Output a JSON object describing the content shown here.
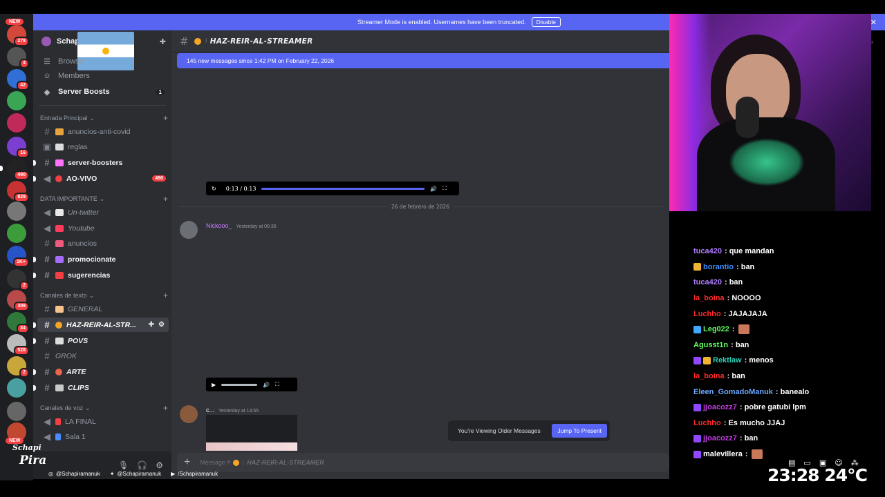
{
  "streamer_banner": {
    "text": "Streamer Mode is enabled. Usernames have been truncated.",
    "disable_label": "Disable"
  },
  "rail": {
    "new_top": "NEW",
    "new_bottom": "NEW",
    "badges": [
      "278",
      "4",
      "42",
      "",
      "",
      "16",
      "490",
      "829",
      "",
      "",
      "1K+",
      "2",
      "309",
      "34",
      "528",
      "2",
      "",
      "",
      ""
    ]
  },
  "server": {
    "name": "Schapi"
  },
  "sidebar": {
    "top": [
      {
        "label": "Browse",
        "icon": "browse-icon"
      },
      {
        "label": "Members",
        "icon": "members-icon"
      },
      {
        "label": "Server Boosts",
        "icon": "boost-icon",
        "count": "1"
      }
    ],
    "categories": [
      {
        "label": "Entrada Principal"
      },
      {
        "label": "DATA IMPORTANTE"
      },
      {
        "label": "Canales de texto"
      },
      {
        "label": "Canales de voz"
      }
    ],
    "channels": [
      {
        "label": "anuncios-anti-covid"
      },
      {
        "label": "reglas"
      },
      {
        "label": "server-boosters"
      },
      {
        "label": "AO-VIVO",
        "count": "490"
      },
      {
        "label": "Un-twitter"
      },
      {
        "label": "Youtube"
      },
      {
        "label": "anuncios"
      },
      {
        "label": "promocionate"
      },
      {
        "label": "sugerencias"
      },
      {
        "label": "GENERAL"
      },
      {
        "label": "HAZ-REIR-AL-STR..."
      },
      {
        "label": "POVS"
      },
      {
        "label": "GROK"
      },
      {
        "label": "ARTE"
      },
      {
        "label": "CLIPS"
      },
      {
        "label": "LA FINAL"
      },
      {
        "label": "Sala 1"
      }
    ]
  },
  "main": {
    "channel_title": "HAZ-REIR-AL-STREAMER",
    "new_messages": "145 new messages since 1:42 PM on February 22, 2026",
    "player1_time": "0:13 / 0:13",
    "player1_progress": 1.0,
    "player2_progress": 0.0,
    "date_divider": "26 de febrero de 2026",
    "msg1_user": "Nickooo_",
    "msg1_time": "Yesterday at 00:35",
    "msg2_user": "c...",
    "msg2_time": "Yesterday at 13:55",
    "older_label": "You're Viewing Older Messages",
    "jump_label": "Jump To Present",
    "composer_placeholder": "Message #",
    "composer_channel": "HAZ-REIR-AL-STREAMER"
  },
  "chat": [
    {
      "user": "tuca420",
      "color": "#b07cff",
      "text": ": que mandan",
      "badges": []
    },
    {
      "user": "borantio",
      "color": "#3f8cff",
      "text": ": ban",
      "badges": [
        "#f0b232"
      ]
    },
    {
      "user": "tuca420",
      "color": "#b07cff",
      "text": ": ban",
      "badges": []
    },
    {
      "user": "la_boina",
      "color": "#ff2a2a",
      "text": ": NOOOO",
      "badges": []
    },
    {
      "user": "Luchho",
      "color": "#ff2a2a",
      "text": ": JAJAJAJA",
      "badges": []
    },
    {
      "user": "Leg022",
      "color": "#5fff5f",
      "text": ":",
      "badges": [
        "#3fa9ff"
      ]
    },
    {
      "user": "Agusst1n",
      "color": "#5fff5f",
      "text": ": ban",
      "badges": []
    },
    {
      "user": "Rektlaw",
      "color": "#2ed1b8",
      "text": ": menos",
      "badges": [
        "#9146ff",
        "#f0b232"
      ]
    },
    {
      "user": "la_boina",
      "color": "#ff2a2a",
      "text": ": ban",
      "badges": []
    },
    {
      "user": "Eleen_GomadoManuk",
      "color": "#6aa8ff",
      "text": ": banealo",
      "badges": []
    },
    {
      "user": "jjoacozz7",
      "color": "#c03ce0",
      "text": ": pobre gatubi lpm",
      "badges": [
        "#9146ff"
      ]
    },
    {
      "user": "Luchho",
      "color": "#ff2a2a",
      "text": ": Es mucho JJAJ",
      "badges": []
    },
    {
      "user": "jjoacozz7",
      "color": "#c03ce0",
      "text": ": ban",
      "badges": [
        "#9146ff"
      ]
    },
    {
      "user": "malevillera",
      "color": "#ffffff",
      "text": ":",
      "badges": [
        "#9146ff"
      ]
    }
  ],
  "overlay": {
    "instagram": "@Schapiramanuk",
    "twitter": "@Schapiramanuk",
    "youtube": "/Schapiramanuk",
    "clock": "23:28",
    "temperature": "24°C",
    "logo_line1": "Schapi",
    "logo_line2": "Pira"
  }
}
